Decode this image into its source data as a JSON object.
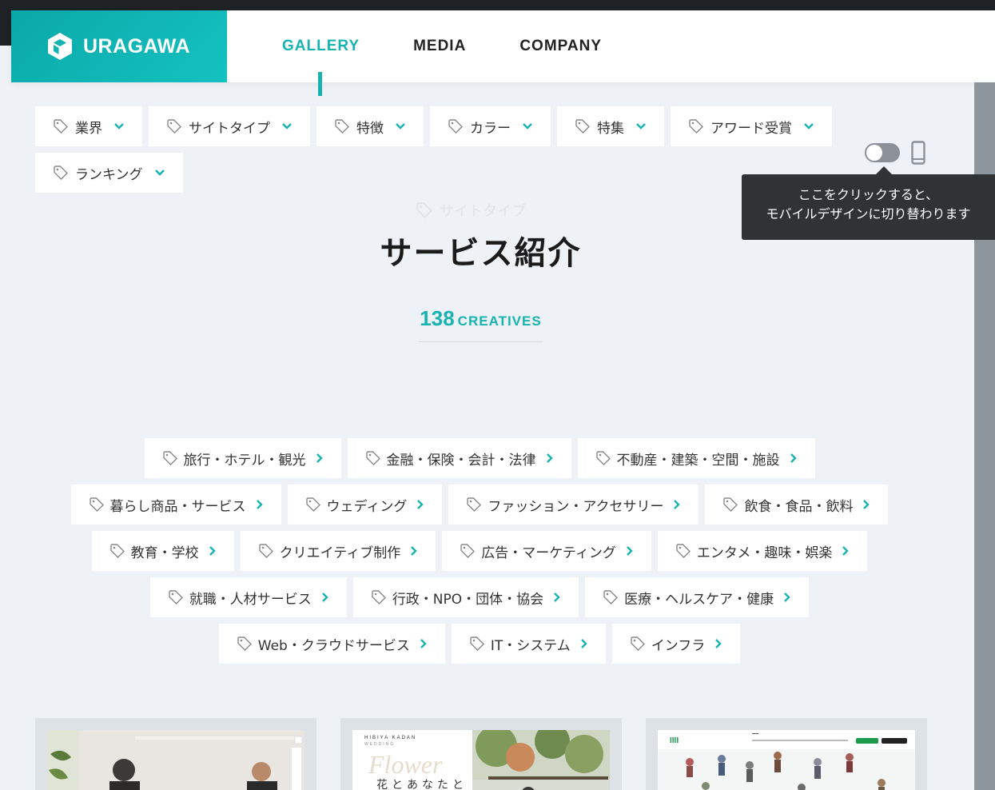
{
  "app": {
    "logo_text": "URAGAWA"
  },
  "nav": [
    {
      "label": "GALLERY",
      "active": true
    },
    {
      "label": "MEDIA",
      "active": false
    },
    {
      "label": "COMPANY",
      "active": false
    }
  ],
  "filters": [
    "業界",
    "サイトタイプ",
    "特徴",
    "カラー",
    "特集",
    "アワード受賞",
    "ランキング"
  ],
  "toggle": {
    "tooltip_line1": "ここをクリックすると、",
    "tooltip_line2": "モバイルデザインに切り替わります"
  },
  "ghost_label": "サイトタイプ",
  "page_title": "サービス紹介",
  "count": {
    "number": "138",
    "label": "CREATIVES"
  },
  "categories": [
    [
      "旅行・ホテル・観光",
      "金融・保険・会計・法律",
      "不動産・建築・空間・施設"
    ],
    [
      "暮らし商品・サービス",
      "ウェディング",
      "ファッション・アクセサリー",
      "飲食・食品・飲料"
    ],
    [
      "教育・学校",
      "クリエイティブ制作",
      "広告・マーケティング",
      "エンタメ・趣味・娯楽"
    ],
    [
      "就職・人材サービス",
      "行政・NPO・団体・協会",
      "医療・ヘルスケア・健康"
    ],
    [
      "Web・クラウドサービス",
      "IT・システム",
      "インフラ"
    ]
  ],
  "cards": [
    {
      "brand": ""
    },
    {
      "brand": "HIBIYA KADAN",
      "sub": "WEDDING",
      "script": "Flower",
      "jp": "花とあなたと"
    },
    {
      "brand": "IIII"
    }
  ],
  "colors": {
    "accent": "#17b3b0",
    "dark": "#1f2224",
    "tooltip": "#2f3336"
  }
}
